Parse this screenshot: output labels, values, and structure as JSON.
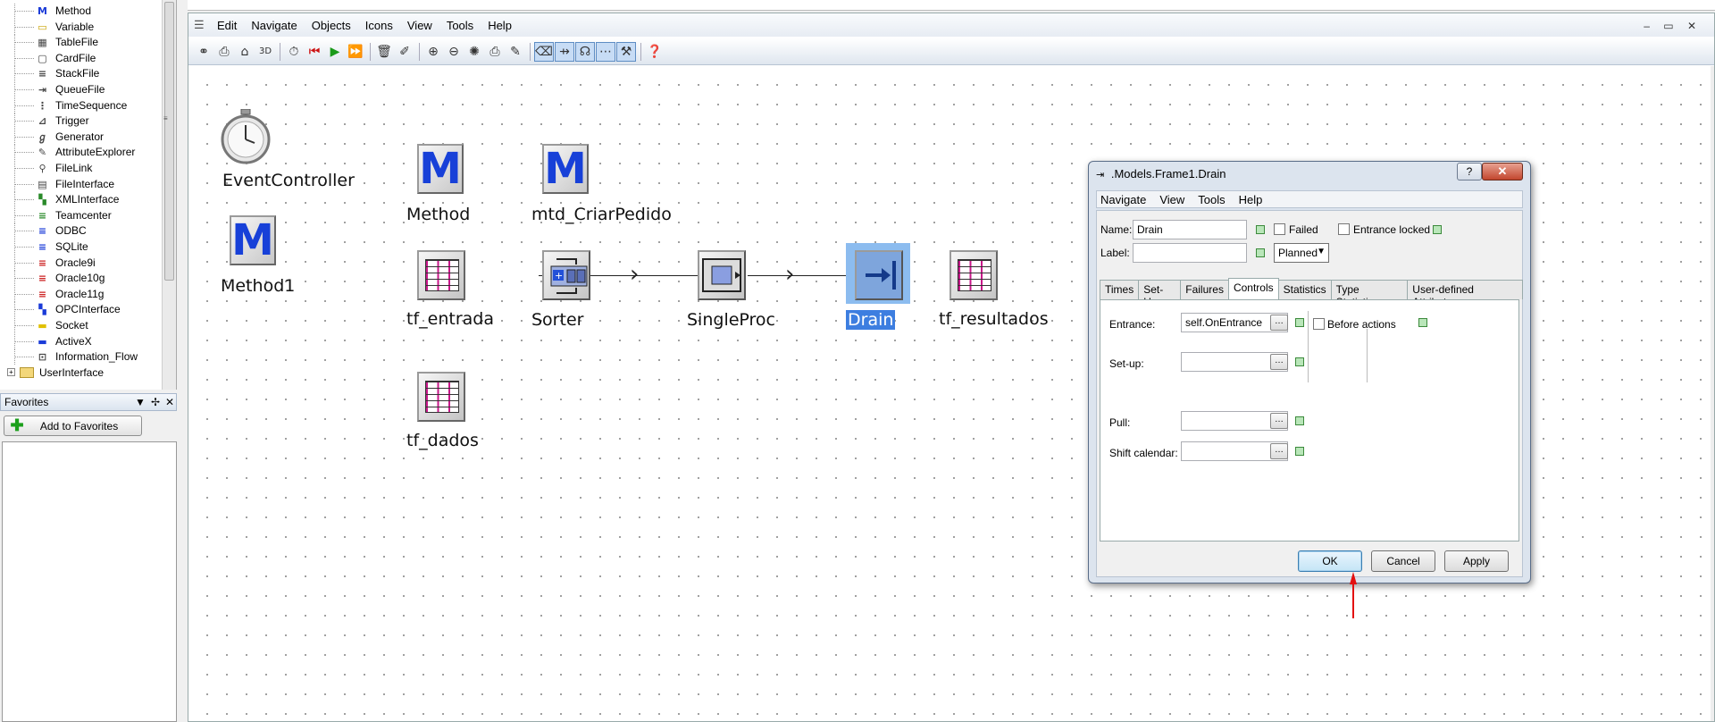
{
  "tree": {
    "items": [
      {
        "icon": "M",
        "label": "Method",
        "color": "#1a3bd8"
      },
      {
        "icon": "▭",
        "label": "Variable",
        "color": "#c9a100"
      },
      {
        "icon": "▦",
        "label": "TableFile",
        "color": "#444"
      },
      {
        "icon": "▢",
        "label": "CardFile",
        "color": "#444"
      },
      {
        "icon": "≡",
        "label": "StackFile",
        "color": "#444"
      },
      {
        "icon": "⇥",
        "label": "QueueFile",
        "color": "#444"
      },
      {
        "icon": "⋮",
        "label": "TimeSequence",
        "color": "#444"
      },
      {
        "icon": "⊿",
        "label": "Trigger",
        "color": "#444"
      },
      {
        "icon": "ℊ",
        "label": "Generator",
        "color": "#444"
      },
      {
        "icon": "✎",
        "label": "AttributeExplorer",
        "color": "#444"
      },
      {
        "icon": "⚲",
        "label": "FileLink",
        "color": "#444"
      },
      {
        "icon": "▤",
        "label": "FileInterface",
        "color": "#444"
      },
      {
        "icon": "▚",
        "label": "XMLInterface",
        "color": "#2a8a2a"
      },
      {
        "icon": "≡",
        "label": "Teamcenter",
        "color": "#2a8a2a"
      },
      {
        "icon": "≡",
        "label": "ODBC",
        "color": "#1a3bd8"
      },
      {
        "icon": "≡",
        "label": "SQLite",
        "color": "#1a3bd8"
      },
      {
        "icon": "≡",
        "label": "Oracle9i",
        "color": "#cc2222"
      },
      {
        "icon": "≡",
        "label": "Oracle10g",
        "color": "#cc2222"
      },
      {
        "icon": "≡",
        "label": "Oracle11g",
        "color": "#cc2222"
      },
      {
        "icon": "▚",
        "label": "OPCInterface",
        "color": "#1a3bd8"
      },
      {
        "icon": "▬",
        "label": "Socket",
        "color": "#e0c000"
      },
      {
        "icon": "▬",
        "label": "ActiveX",
        "color": "#1a3bd8"
      },
      {
        "icon": "⊡",
        "label": "Information_Flow",
        "color": "#444"
      }
    ],
    "folder": "UserInterface"
  },
  "favorites": {
    "title": "Favorites",
    "add_label": "Add to Favorites"
  },
  "main": {
    "menu": [
      "Edit",
      "Navigate",
      "Objects",
      "Icons",
      "View",
      "Tools",
      "Help"
    ],
    "window_controls": "– ▭ ✕"
  },
  "canvas": {
    "objects": {
      "event_controller": "EventController",
      "method1": "Method1",
      "method": "Method",
      "mtd_criar_pedido": "mtd_CriarPedido",
      "tf_entrada": "tf_entrada",
      "sorter": "Sorter",
      "single_proc": "SingleProc",
      "drain": "Drain",
      "tf_resultados": "tf_resultados",
      "tf_dados": "tf_dados"
    }
  },
  "dialog": {
    "title": ".Models.Frame1.Drain",
    "help_btn": "?",
    "close_btn": "✕",
    "menu": [
      "Navigate",
      "View",
      "Tools",
      "Help"
    ],
    "name_label": "Name:",
    "name_value": "Drain",
    "label_label": "Label:",
    "label_value": "",
    "failed_label": "Failed",
    "entrance_locked_label": "Entrance locked",
    "planned_value": "Planned",
    "tabs": [
      "Times",
      "Set-Up",
      "Failures",
      "Controls",
      "Statistics",
      "Type Statistics",
      "User-defined Attributes"
    ],
    "active_tab": "Controls",
    "entrance_label": "Entrance:",
    "entrance_value": "self.OnEntrance",
    "before_actions_label": "Before actions",
    "setup_label": "Set-up:",
    "pull_label": "Pull:",
    "shift_calendar_label": "Shift calendar:",
    "ok": "OK",
    "cancel": "Cancel",
    "apply": "Apply"
  },
  "colors": {
    "selection": "#8cbcef",
    "method_blue": "#1740d8",
    "table_magenta": "#c8188a",
    "annotation_arrow": "#e31010"
  }
}
